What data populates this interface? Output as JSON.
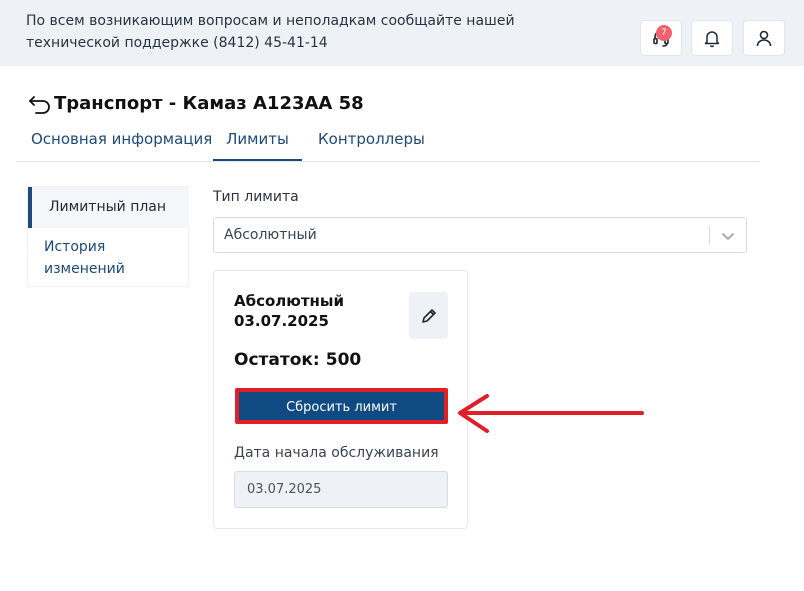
{
  "header": {
    "message": "По всем возникающим вопросам и неполадкам сообщайте нашей технической поддержке (8412) 45-41-14",
    "support_badge": "7"
  },
  "page": {
    "title": "Транспорт - Камаз А123АА 58"
  },
  "tabs": [
    {
      "label": "Основная информация"
    },
    {
      "label": "Лимиты"
    },
    {
      "label": "Контроллеры"
    }
  ],
  "sidebar": {
    "items": [
      {
        "label": "Лимитный план"
      },
      {
        "label": "История изменений"
      }
    ]
  },
  "limit_type": {
    "label": "Тип лимита",
    "value": "Абсолютный"
  },
  "card": {
    "title": "Абсолютный",
    "date": "03.07.2025",
    "remaining_label": "Остаток:",
    "remaining_value": "500",
    "reset_label": "Сбросить лимит",
    "service_date_label": "Дата начала обслуживания",
    "service_date_value": "03.07.2025"
  },
  "colors": {
    "primary": "#0f4a82",
    "annotation": "#e01f26",
    "badge": "#f0626d"
  }
}
